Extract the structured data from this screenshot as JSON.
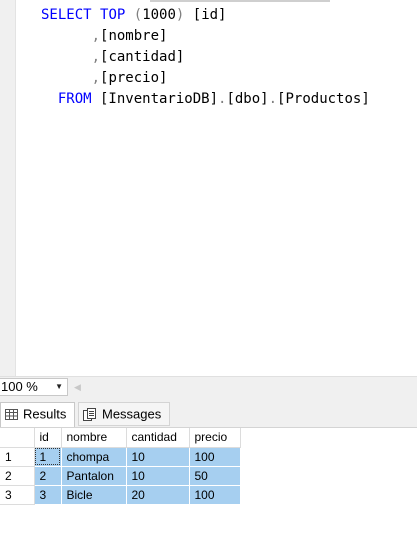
{
  "editor": {
    "lines": [
      {
        "tokens": [
          {
            "t": "SELECT",
            "c": "kw"
          },
          {
            "t": " "
          },
          {
            "t": "TOP",
            "c": "kw"
          },
          {
            "t": " "
          },
          {
            "t": "(",
            "c": "gr"
          },
          {
            "t": "1000"
          },
          {
            "t": ")",
            "c": "gr"
          },
          {
            "t": " [id]"
          }
        ]
      },
      {
        "tokens": [
          {
            "t": "      "
          },
          {
            "t": ",",
            "c": "gr"
          },
          {
            "t": "[nombre]"
          }
        ]
      },
      {
        "tokens": [
          {
            "t": "      "
          },
          {
            "t": ",",
            "c": "gr"
          },
          {
            "t": "[cantidad]"
          }
        ]
      },
      {
        "tokens": [
          {
            "t": "      "
          },
          {
            "t": ",",
            "c": "gr"
          },
          {
            "t": "[precio]"
          }
        ]
      },
      {
        "tokens": [
          {
            "t": "  "
          },
          {
            "t": "FROM",
            "c": "kw"
          },
          {
            "t": " [InventarioDB]"
          },
          {
            "t": ".",
            "c": "gr"
          },
          {
            "t": "[dbo]"
          },
          {
            "t": ".",
            "c": "gr"
          },
          {
            "t": "[Productos]"
          }
        ]
      }
    ]
  },
  "zoom": {
    "value": "100 %"
  },
  "tabs": {
    "results": "Results",
    "messages": "Messages"
  },
  "grid": {
    "columns": [
      "id",
      "nombre",
      "cantidad",
      "precio"
    ],
    "rows": [
      {
        "num": "1",
        "cells": [
          "1",
          "chompa",
          "10",
          "100"
        ]
      },
      {
        "num": "2",
        "cells": [
          "2",
          "Pantalon",
          "10",
          "50"
        ]
      },
      {
        "num": "3",
        "cells": [
          "3",
          "Bicle",
          "20",
          "100"
        ]
      }
    ]
  },
  "colors": {
    "keyword": "#0000ff",
    "operator": "#808080",
    "selection": "#a6cff0"
  },
  "icons": {
    "results_tab": "grid-icon",
    "messages_tab": "messages-icon",
    "zoom": "chevron-down-icon",
    "scroll": "scroll-left-icon"
  }
}
